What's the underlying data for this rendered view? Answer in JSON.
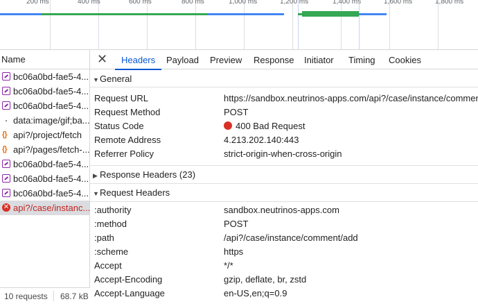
{
  "timeline": {
    "ticks": [
      "200 ms",
      "400 ms",
      "600 ms",
      "800 ms",
      "1,000 ms",
      "1,200 ms",
      "1,400 ms",
      "1,600 ms",
      "1,800 ms"
    ]
  },
  "request_list": {
    "header": "Name",
    "items": [
      {
        "label": "bc06a0bd-fae5-4...",
        "icon": "document-icon"
      },
      {
        "label": "bc06a0bd-fae5-4...",
        "icon": "document-icon"
      },
      {
        "label": "bc06a0bd-fae5-4...",
        "icon": "document-icon"
      },
      {
        "label": "data:image/gif;ba...",
        "icon": "image-icon"
      },
      {
        "label": "api?/project/fetch",
        "icon": "json-icon"
      },
      {
        "label": "api?/pages/fetch-...",
        "icon": "json-icon"
      },
      {
        "label": "bc06a0bd-fae5-4...",
        "icon": "document-icon"
      },
      {
        "label": "bc06a0bd-fae5-4...",
        "icon": "document-icon"
      },
      {
        "label": "bc06a0bd-fae5-4...",
        "icon": "document-icon"
      },
      {
        "label": "api?/case/instanc...",
        "icon": "error-icon",
        "selected": true
      }
    ],
    "footer": {
      "requests": "10 requests",
      "transferred": "68.7 kB"
    }
  },
  "tabs": {
    "close": "✕",
    "items": [
      "Headers",
      "Payload",
      "Preview",
      "Response",
      "Initiator",
      "Timing",
      "Cookies"
    ],
    "active": "Headers"
  },
  "general": {
    "title": "General",
    "rows": [
      {
        "key": "Request URL",
        "value": "https://sandbox.neutrinos-apps.com/api?/case/instance/comment/add"
      },
      {
        "key": "Request Method",
        "value": "POST"
      },
      {
        "key": "Status Code",
        "value": "400 Bad Request"
      },
      {
        "key": "Remote Address",
        "value": "4.213.202.140:443"
      },
      {
        "key": "Referrer Policy",
        "value": "strict-origin-when-cross-origin"
      }
    ]
  },
  "response_headers": {
    "title": "Response Headers (23)"
  },
  "request_headers": {
    "title": "Request Headers",
    "rows": [
      {
        "key": ":authority",
        "value": "sandbox.neutrinos-apps.com"
      },
      {
        "key": ":method",
        "value": "POST"
      },
      {
        "key": ":path",
        "value": "/api?/case/instance/comment/add"
      },
      {
        "key": ":scheme",
        "value": "https"
      },
      {
        "key": "Accept",
        "value": "*/*"
      },
      {
        "key": "Accept-Encoding",
        "value": "gzip, deflate, br, zstd"
      },
      {
        "key": "Accept-Language",
        "value": "en-US,en;q=0.9"
      }
    ]
  },
  "colors": {
    "accent": "#0b57d0",
    "error": "#d93025",
    "timeline_green": "#34a853",
    "timeline_blue": "#4285f4"
  }
}
